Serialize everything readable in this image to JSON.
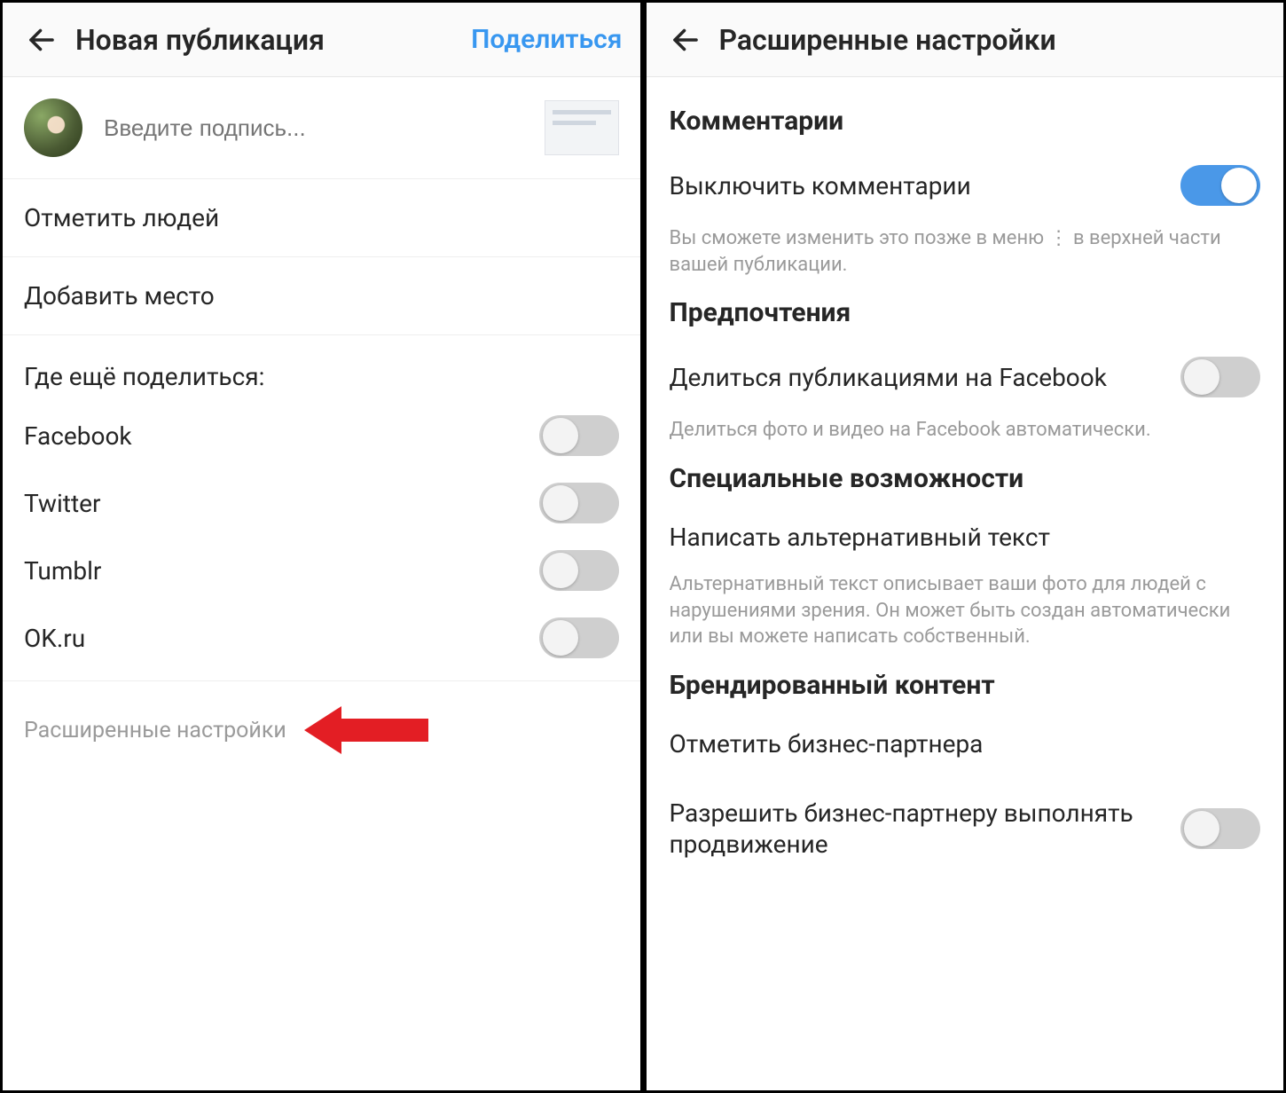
{
  "left": {
    "header": {
      "title": "Новая публикация",
      "action": "Поделиться"
    },
    "caption_placeholder": "Введите подпись...",
    "rows": {
      "tag_people": "Отметить людей",
      "add_location": "Добавить место"
    },
    "share_section_label": "Где ещё поделиться:",
    "share_targets": [
      {
        "name": "Facebook",
        "on": false
      },
      {
        "name": "Twitter",
        "on": false
      },
      {
        "name": "Tumblr",
        "on": false
      },
      {
        "name": "OK.ru",
        "on": false
      }
    ],
    "advanced_label": "Расширенные настройки"
  },
  "right": {
    "header": {
      "title": "Расширенные настройки"
    },
    "sections": {
      "comments": {
        "title": "Комментарии",
        "toggle_label": "Выключить комментарии",
        "toggle_on": true,
        "desc": "Вы сможете изменить это позже в меню ⋮ в верхней части вашей публикации."
      },
      "prefs": {
        "title": "Предпочтения",
        "toggle_label": "Делиться публикациями на Facebook",
        "toggle_on": false,
        "desc": "Делиться фото и видео на Facebook автоматически."
      },
      "accessibility": {
        "title": "Специальные возможности",
        "link_label": "Написать альтернативный текст",
        "desc": "Альтернативный текст описывает ваши фото для людей с нарушениями зрения. Он может быть создан автоматически или вы можете написать собственный."
      },
      "branded": {
        "title": "Брендированный контент",
        "tag_partner_label": "Отметить бизнес-партнера",
        "allow_promote_label": "Разрешить бизнес-партнеру выполнять продвижение",
        "allow_promote_on": false
      }
    }
  },
  "colors": {
    "accent": "#3897f0",
    "pointer": "#e31e24",
    "toggle_on": "#4a98e8"
  }
}
